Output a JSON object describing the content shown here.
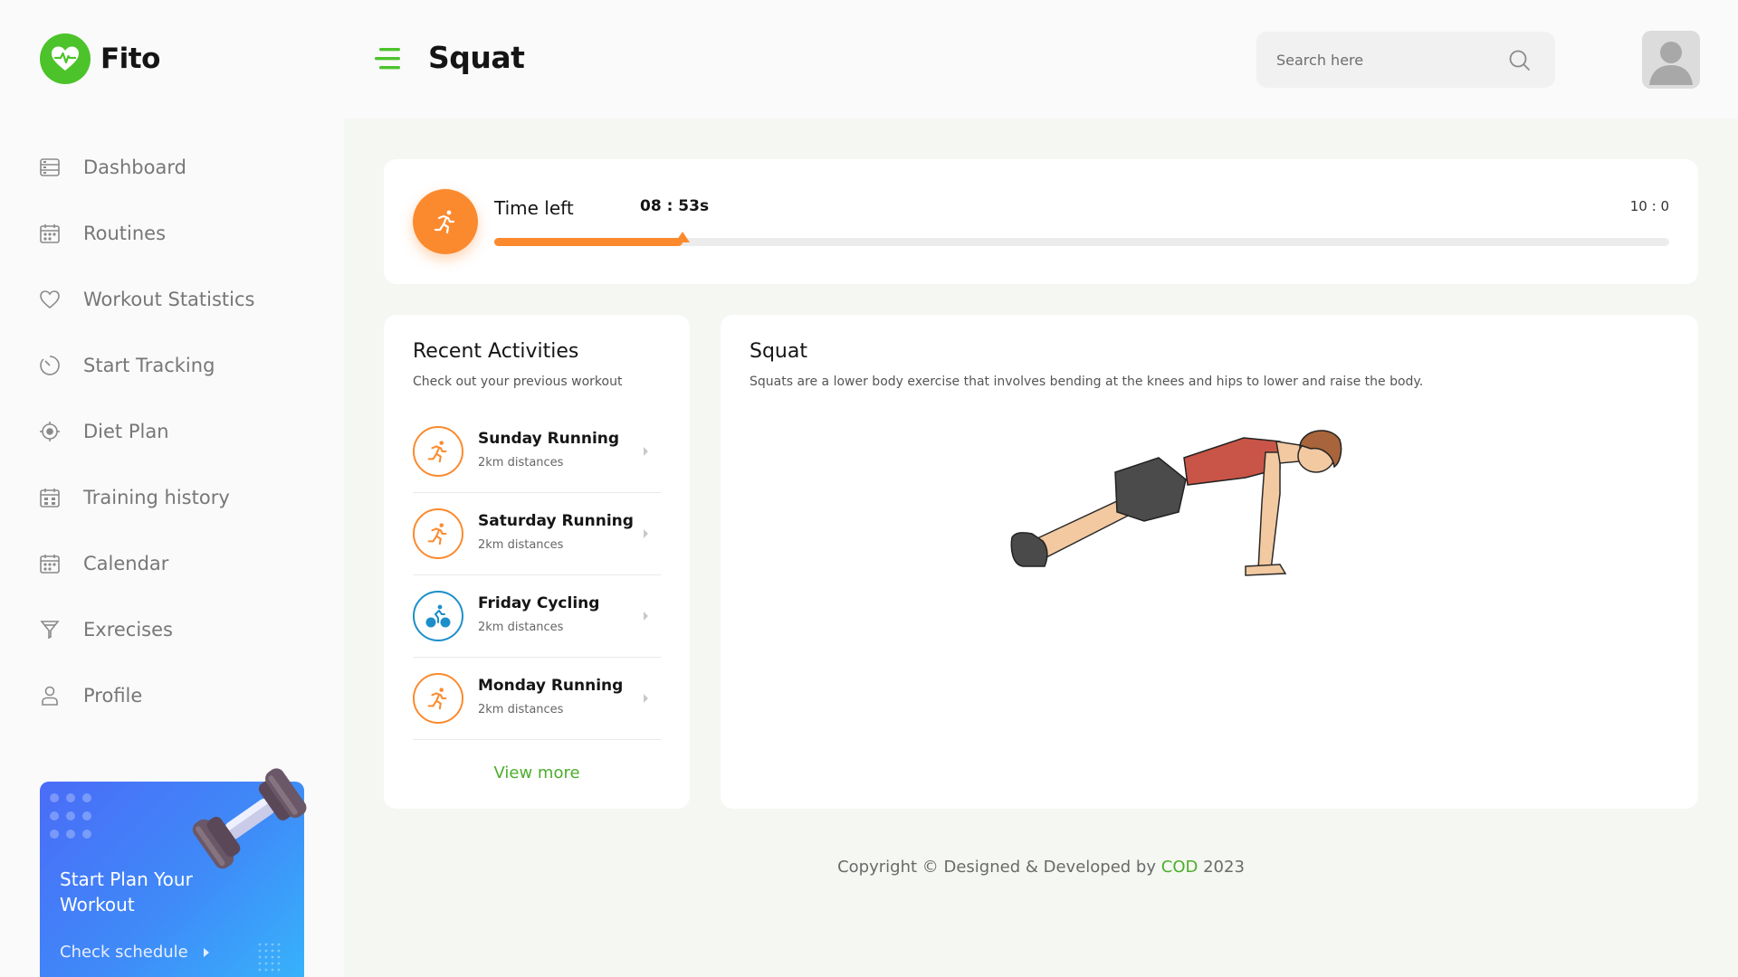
{
  "app": {
    "name": "Fito",
    "logo_icon": "heart-pulse-icon",
    "brand_color": "#4cc32b",
    "accent_color": "#fb8a2e"
  },
  "header": {
    "title": "Squat",
    "search_placeholder": "Search here",
    "menu_icon": "hamburger-menu-icon",
    "search_icon": "search-icon",
    "avatar_icon": "user-avatar-icon"
  },
  "sidebar": {
    "items": [
      {
        "label": "Dashboard",
        "icon": "dashboard-icon"
      },
      {
        "label": "Routines",
        "icon": "calendar-icon"
      },
      {
        "label": "Workout Statistics",
        "icon": "heart-icon"
      },
      {
        "label": "Start Tracking",
        "icon": "timer-icon"
      },
      {
        "label": "Diet Plan",
        "icon": "target-icon"
      },
      {
        "label": "Training history",
        "icon": "calendar-grid-icon"
      },
      {
        "label": "Calendar",
        "icon": "calendar-icon"
      },
      {
        "label": "Exrecises",
        "icon": "trophy-icon"
      },
      {
        "label": "Profile",
        "icon": "user-icon"
      }
    ],
    "promo": {
      "title": "Start Plan Your Workout",
      "link": "Check schedule"
    }
  },
  "timer": {
    "label": "Time left",
    "value": "08 : 53s",
    "total": "10 : 0",
    "progress": 0.16,
    "icon": "running-icon"
  },
  "recent": {
    "title": "Recent Activities",
    "subtitle": "Check out your previous workout",
    "items": [
      {
        "name": "Sunday Running",
        "detail": "2km distances",
        "icon": "running-icon"
      },
      {
        "name": "Saturday Running",
        "detail": "2km distances",
        "icon": "running-icon"
      },
      {
        "name": "Friday Cycling",
        "detail": "2km distances",
        "icon": "cycling-icon"
      },
      {
        "name": "Monday Running",
        "detail": "2km distances",
        "icon": "running-icon"
      }
    ],
    "view_more": "View more"
  },
  "exercise": {
    "title": "Squat",
    "description": "Squats are a lower body exercise that involves bending at the knees and hips to lower and raise the body."
  },
  "footer": {
    "prefix": "Copyright © Designed & Developed by",
    "brand": "COD",
    "year": "2023"
  }
}
